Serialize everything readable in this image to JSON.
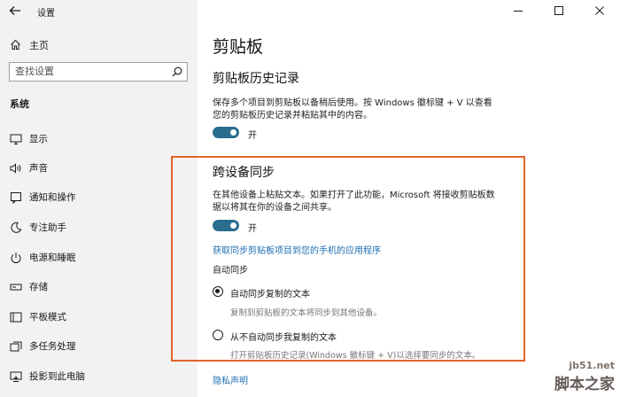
{
  "window": {
    "title": "设置",
    "controls": [
      "minimize",
      "maximize",
      "close"
    ]
  },
  "sidebar": {
    "home_label": "主页",
    "search_placeholder": "查找设置",
    "section_label": "系统",
    "items": [
      {
        "label": "显示",
        "icon": "display-icon"
      },
      {
        "label": "声音",
        "icon": "sound-icon"
      },
      {
        "label": "通知和操作",
        "icon": "notifications-icon"
      },
      {
        "label": "专注助手",
        "icon": "focus-assist-icon"
      },
      {
        "label": "电源和睡眠",
        "icon": "power-icon"
      },
      {
        "label": "存储",
        "icon": "storage-icon"
      },
      {
        "label": "平板模式",
        "icon": "tablet-mode-icon"
      },
      {
        "label": "多任务处理",
        "icon": "multitasking-icon"
      },
      {
        "label": "投影到此电脑",
        "icon": "project-icon"
      }
    ]
  },
  "main": {
    "page_title": "剪贴板",
    "history": {
      "heading": "剪贴板历史记录",
      "description_line1": "保存多个项目到剪贴板以备稍后使用。按 Windows 徽标键 + V 以查看",
      "description_line2": "您的剪贴板历史记录并粘贴其中的内容。",
      "toggle_label": "开"
    },
    "sync": {
      "heading": "跨设备同步",
      "description_line1": "在其他设备上粘贴文本。如果打开了此功能，Microsoft 将接收剪贴板数",
      "description_line2": "据以将其在你的设备之间共享。",
      "toggle_label": "开",
      "link": "获取同步剪贴板项目到您的手机的应用程序",
      "auto_sync_label": "自动同步",
      "option1_label": "自动同步复制的文本",
      "option1_desc": "复制到剪贴板的文本将同步到其他设备。",
      "option2_label": "从不自动同步我复制的文本",
      "option2_desc": "打开剪贴板历史记录(Windows 徽标键 + V)以选择要同步的文本。",
      "selected_option": 1
    },
    "privacy_link": "隐私声明"
  },
  "watermark": {
    "url": "jb51.net",
    "name": "脚本之家"
  },
  "colors": {
    "accent": "#2a6e8f",
    "link": "#1f6fb1",
    "highlight_border": "#e2642a",
    "sidebar_bg": "#f2f2f2"
  }
}
